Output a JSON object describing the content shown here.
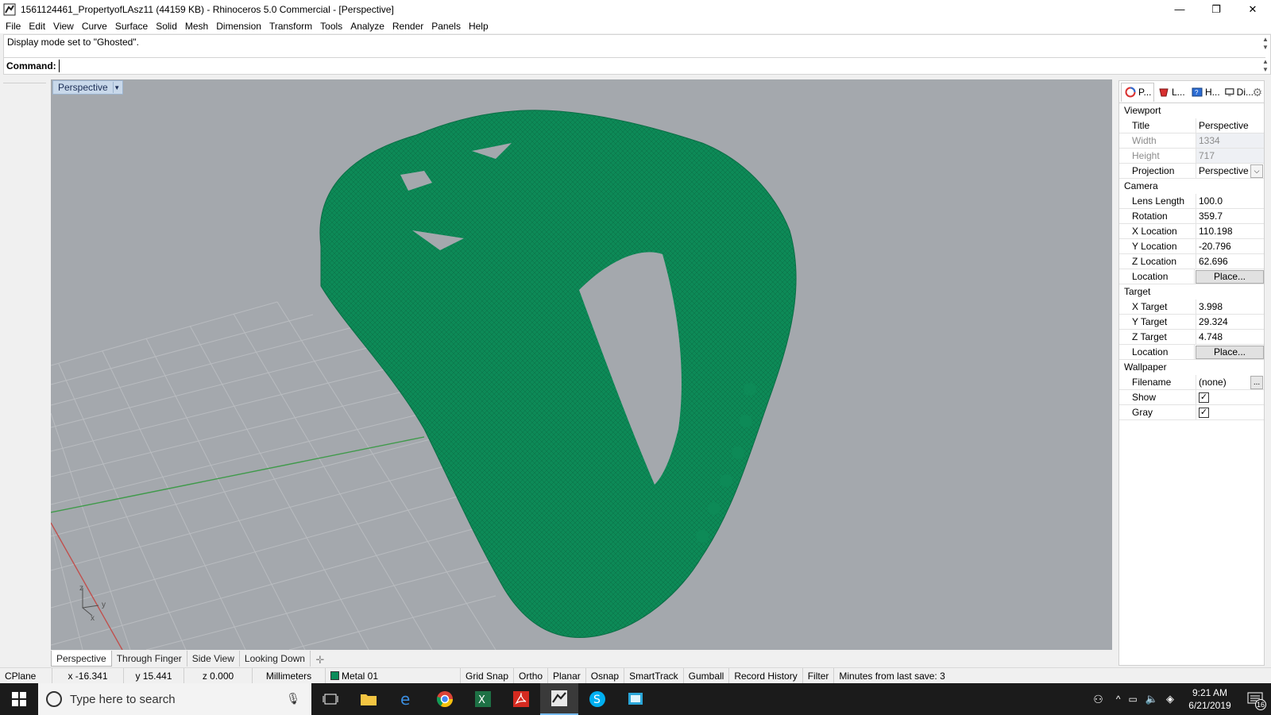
{
  "window": {
    "title": "1561124461_PropertyofLAsz11 (44159 KB) - Rhinoceros 5.0 Commercial - [Perspective]",
    "controls": [
      "—",
      "❐",
      "✕"
    ]
  },
  "menu": [
    "File",
    "Edit",
    "View",
    "Curve",
    "Surface",
    "Solid",
    "Mesh",
    "Dimension",
    "Transform",
    "Tools",
    "Analyze",
    "Render",
    "Panels",
    "Help"
  ],
  "command": {
    "history": "Display mode set to \"Ghosted\".",
    "prompt_label": "Command:",
    "value": ""
  },
  "viewport": {
    "title": "Perspective",
    "model_color": "#0d8a57",
    "background": "#a4a8ad",
    "axis_labels": [
      "z",
      "y",
      "x"
    ]
  },
  "viewport_tabs": [
    "Perspective",
    "Through Finger",
    "Side View",
    "Looking Down"
  ],
  "panel": {
    "tabs": [
      "P...",
      "L...",
      "H...",
      "Di..."
    ],
    "sections": {
      "viewport": "Viewport",
      "camera": "Camera",
      "target": "Target",
      "wallpaper": "Wallpaper"
    },
    "viewport": {
      "title_label": "Title",
      "title_value": "Perspective",
      "width_label": "Width",
      "width_value": "1334",
      "height_label": "Height",
      "height_value": "717",
      "projection_label": "Projection",
      "projection_value": "Perspective"
    },
    "camera": {
      "lens_label": "Lens Length",
      "lens_value": "100.0",
      "rotation_label": "Rotation",
      "rotation_value": "359.7",
      "x_label": "X Location",
      "x_value": "110.198",
      "y_label": "Y Location",
      "y_value": "-20.796",
      "z_label": "Z Location",
      "z_value": "62.696",
      "location_label": "Location",
      "place_button": "Place..."
    },
    "target": {
      "x_label": "X Target",
      "x_value": "3.998",
      "y_label": "Y Target",
      "y_value": "29.324",
      "z_label": "Z Target",
      "z_value": "4.748",
      "location_label": "Location",
      "place_button": "Place..."
    },
    "wallpaper": {
      "filename_label": "Filename",
      "filename_value": "(none)",
      "browse_button": "...",
      "show_label": "Show",
      "show_checked": true,
      "gray_label": "Gray",
      "gray_checked": true
    }
  },
  "status": {
    "cplane": "CPlane",
    "x": "x -16.341",
    "y": "y 15.441",
    "z": "z 0.000",
    "units": "Millimeters",
    "layer": "Metal 01",
    "layer_color": "#0c8c5a",
    "grid_snap": "Grid Snap",
    "ortho": "Ortho",
    "planar": "Planar",
    "osnap": "Osnap",
    "smarttrack": "SmartTrack",
    "gumball": "Gumball",
    "record_history": "Record History",
    "filter": "Filter",
    "minutes": "Minutes from last save: 3"
  },
  "taskbar": {
    "search_placeholder": "Type here to search",
    "time": "9:21 AM",
    "date": "6/21/2019",
    "notifications": "16"
  }
}
